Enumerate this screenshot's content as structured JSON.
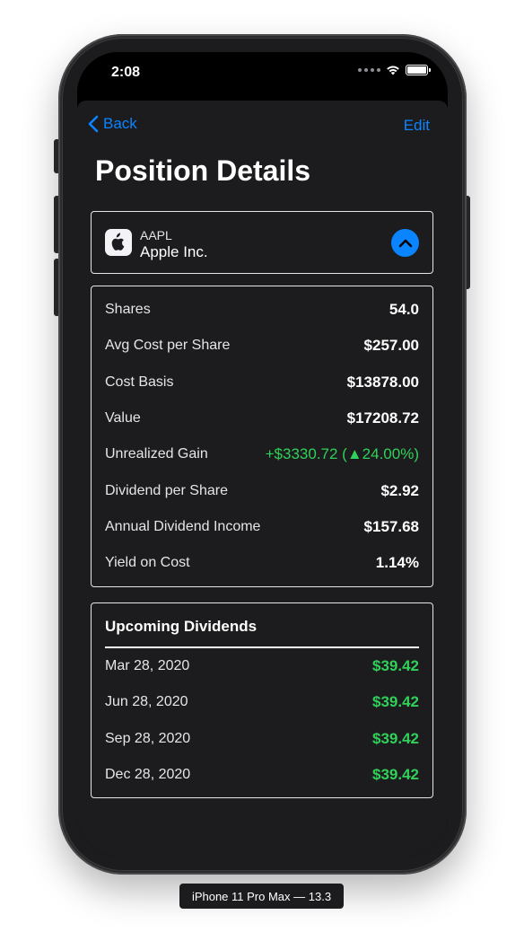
{
  "status_bar": {
    "time": "2:08"
  },
  "nav": {
    "back_label": "Back",
    "edit_label": "Edit"
  },
  "page": {
    "title": "Position Details"
  },
  "stock": {
    "ticker": "AAPL",
    "company": "Apple Inc.",
    "logo_icon": "apple-logo-icon",
    "toggle_icon": "chevron-up-icon"
  },
  "details": [
    {
      "label": "Shares",
      "value": "54.0"
    },
    {
      "label": "Avg Cost per Share",
      "value": "$257.00"
    },
    {
      "label": "Cost Basis",
      "value": "$13878.00"
    },
    {
      "label": "Value",
      "value": "$17208.72"
    },
    {
      "label": "Unrealized Gain",
      "value": "+$3330.72 (▲24.00%)"
    },
    {
      "label": "Dividend per Share",
      "value": "$2.92"
    },
    {
      "label": "Annual Dividend Income",
      "value": "$157.68"
    },
    {
      "label": "Yield on Cost",
      "value": "1.14%"
    }
  ],
  "dividends": {
    "header": "Upcoming Dividends",
    "items": [
      {
        "date": "Mar 28, 2020",
        "amount": "$39.42"
      },
      {
        "date": "Jun 28, 2020",
        "amount": "$39.42"
      },
      {
        "date": "Sep 28, 2020",
        "amount": "$39.42"
      },
      {
        "date": "Dec 28, 2020",
        "amount": "$39.42"
      }
    ]
  },
  "device_label": "iPhone 11 Pro Max — 13.3",
  "colors": {
    "accent": "#0a84ff",
    "positive": "#30d158",
    "background": "#1c1c1e"
  }
}
